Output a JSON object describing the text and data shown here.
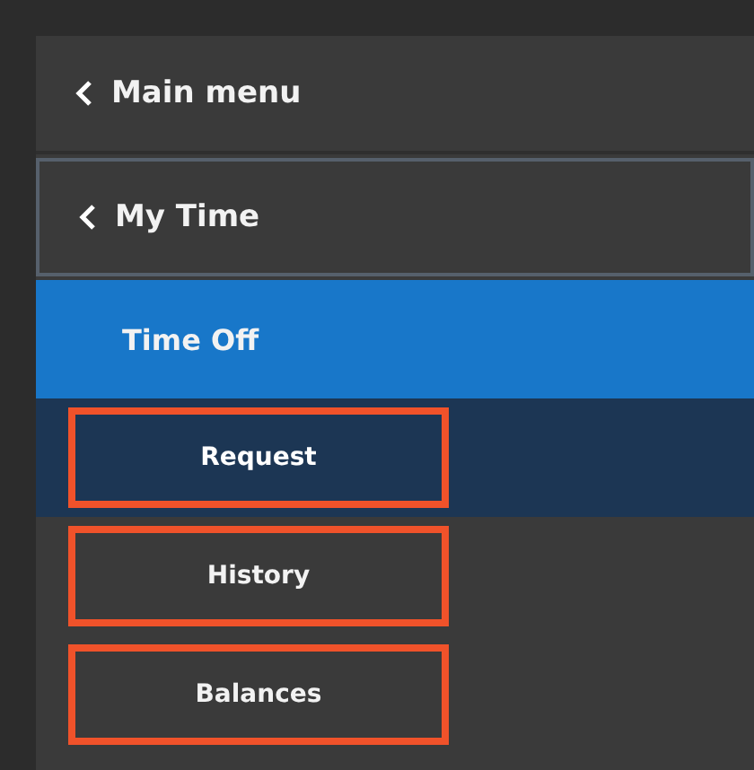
{
  "menu": [
    {
      "kind": "back",
      "label": "Main menu",
      "boxed": false,
      "selected": false,
      "highlighted": false
    },
    {
      "kind": "back",
      "label": "My Time",
      "boxed": true,
      "selected": false,
      "highlighted": false
    },
    {
      "kind": "section",
      "label": "Time Off",
      "boxed": false,
      "selected": false,
      "highlighted": false
    },
    {
      "kind": "item",
      "label": "Request",
      "boxed": false,
      "selected": true,
      "highlighted": true
    },
    {
      "kind": "item",
      "label": "History",
      "boxed": false,
      "selected": false,
      "highlighted": true
    },
    {
      "kind": "item",
      "label": "Balances",
      "boxed": false,
      "selected": false,
      "highlighted": true
    }
  ]
}
